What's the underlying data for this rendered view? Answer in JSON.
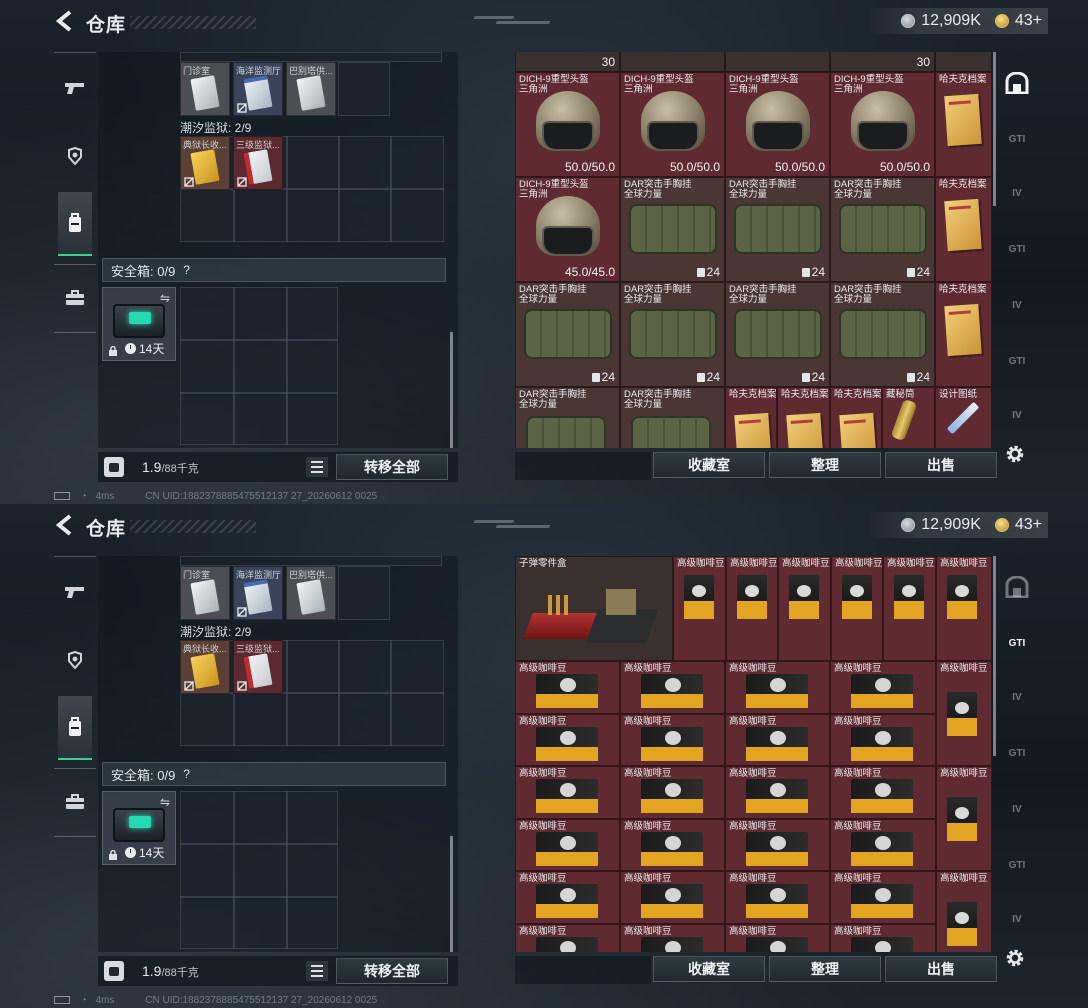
{
  "header": {
    "title": "仓库",
    "currency_value": "12,909K",
    "level_value": "43+"
  },
  "left_container": {
    "top_items": [
      "门诊室",
      "海洋监测厅",
      "巴别塔供..."
    ],
    "prison_label": "潮汐监狱: 2/9",
    "prison_items": [
      "典狱长收...",
      "三级监狱..."
    ],
    "safebox_label": "安全箱: 0/9",
    "safebox_help": "?",
    "case_time": "14天",
    "weight_value": "1.9",
    "weight_unit": "/88千克",
    "transfer_label": "转移全部"
  },
  "stash_buttons": {
    "collection": "收藏室",
    "organize": "整理",
    "sell": "出售"
  },
  "right_tabs": [
    "GTI",
    "IV",
    "GTI",
    "IV",
    "GTI",
    "IV"
  ],
  "status_bar": {
    "ping": "4ms",
    "uid": "CN UID:1882378885475512137 27_20260612 0025"
  },
  "view1": {
    "top_counts": [
      "30",
      "30"
    ],
    "row1": [
      {
        "name": "DICH-9重型头盔",
        "sub": "三角洲",
        "value": "50.0/50.0"
      },
      {
        "name": "DICH-9重型头盔",
        "sub": "三角洲",
        "value": "50.0/50.0"
      },
      {
        "name": "DICH-9重型头盔",
        "sub": "三角洲",
        "value": "50.0/50.0"
      },
      {
        "name": "DICH-9重型头盔",
        "sub": "三角洲",
        "value": "50.0/50.0"
      },
      {
        "name": "哈夫克档案",
        "sub": "",
        "value": ""
      }
    ],
    "row2": [
      {
        "name": "DICH-9重型头盔",
        "sub": "三角洲",
        "value": "45.0/45.0"
      },
      {
        "name": "DAR突击手胸挂",
        "sub": "全球力量",
        "value": "24"
      },
      {
        "name": "DAR突击手胸挂",
        "sub": "全球力量",
        "value": "24"
      },
      {
        "name": "DAR突击手胸挂",
        "sub": "全球力量",
        "value": "24"
      },
      {
        "name": "哈夫克档案",
        "sub": "",
        "value": ""
      }
    ],
    "row3": [
      {
        "name": "DAR突击手胸挂",
        "sub": "全球力量",
        "value": "24"
      },
      {
        "name": "DAR突击手胸挂",
        "sub": "全球力量",
        "value": "24"
      },
      {
        "name": "DAR突击手胸挂",
        "sub": "全球力量",
        "value": "24"
      },
      {
        "name": "DAR突击手胸挂",
        "sub": "全球力量",
        "value": "24"
      },
      {
        "name": "哈夫克档案",
        "sub": "",
        "value": ""
      }
    ],
    "row4": [
      {
        "name": "DAR突击手胸挂",
        "sub": "全球力量",
        "value": ""
      },
      {
        "name": "DAR突击手胸挂",
        "sub": "全球力量",
        "value": ""
      },
      {
        "name": "哈夫克档案",
        "sub": "",
        "value": ""
      },
      {
        "name": "哈夫克档案",
        "sub": "",
        "value": ""
      },
      {
        "name": "哈夫克档案",
        "sub": "",
        "value": ""
      },
      {
        "name": "藏秘筒",
        "sub": "",
        "value": ""
      },
      {
        "name": "设计图纸",
        "sub": "",
        "value": ""
      }
    ]
  },
  "view2": {
    "big_item": "子弹零件盒",
    "coffee_label": "高级咖啡豆"
  }
}
